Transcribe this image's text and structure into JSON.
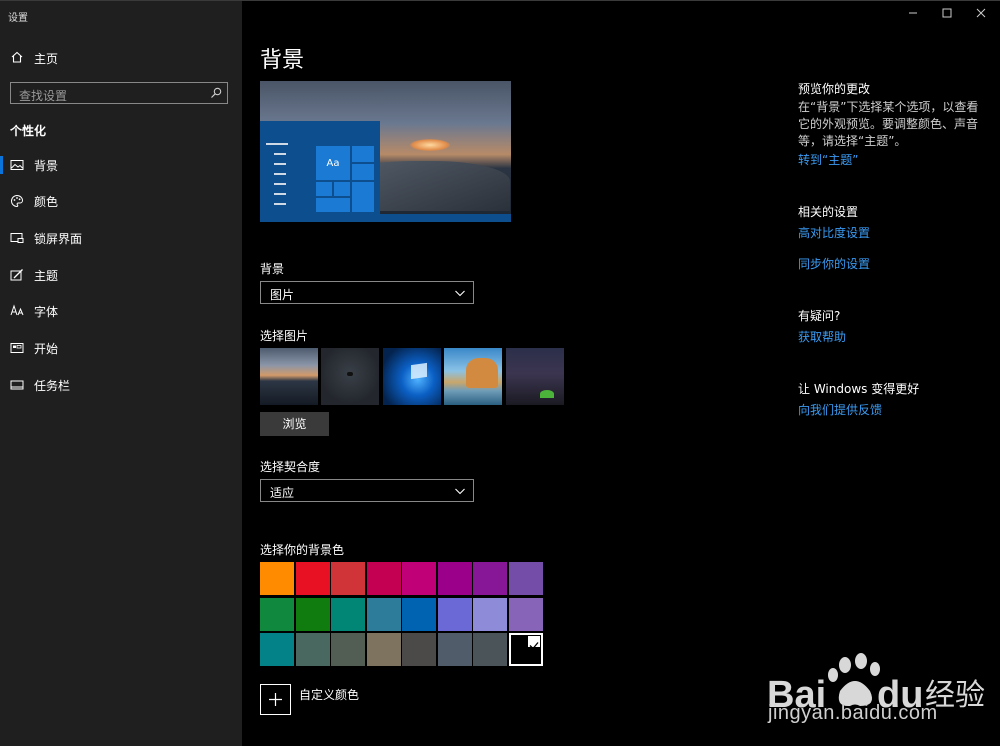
{
  "window": {
    "app_title": "设置"
  },
  "sidebar": {
    "home_label": "主页",
    "search_placeholder": "查找设置",
    "group_title": "个性化",
    "items": [
      {
        "label": "背景",
        "icon": "picture-icon",
        "active": true
      },
      {
        "label": "颜色",
        "icon": "palette-icon",
        "active": false
      },
      {
        "label": "锁屏界面",
        "icon": "lock-screen-icon",
        "active": false
      },
      {
        "label": "主题",
        "icon": "theme-icon",
        "active": false
      },
      {
        "label": "字体",
        "icon": "font-icon",
        "active": false
      },
      {
        "label": "开始",
        "icon": "start-icon",
        "active": false
      },
      {
        "label": "任务栏",
        "icon": "taskbar-icon",
        "active": false
      }
    ]
  },
  "main": {
    "page_title": "背景",
    "preview_sample_text": "Aa",
    "background_label": "背景",
    "background_value": "图片",
    "choose_picture_label": "选择图片",
    "browse_label": "浏览",
    "fit_label": "选择契合度",
    "fit_value": "适应",
    "color_label": "选择你的背景色",
    "custom_color_label": "自定义颜色",
    "colors": [
      "#ff8c00",
      "#e81123",
      "#d13438",
      "#c30052",
      "#bf0077",
      "#9a0089",
      "#881798",
      "#744da9",
      "#10893e",
      "#107c10",
      "#018574",
      "#2d7d9a",
      "#0063b1",
      "#6b69d6",
      "#8e8cd8",
      "#8764b8",
      "#038387",
      "#486860",
      "#525e54",
      "#7e735f",
      "#4c4a48",
      "#515c6b",
      "#4a5459",
      "#000000"
    ],
    "selected_color": "#000000"
  },
  "right": {
    "preview_heading": "预览你的更改",
    "preview_body": "在“背景”下选择某个选项，以查看它的外观预览。要调整颜色、声音等，请选择“主题”。",
    "preview_link": "转到“主题”",
    "related_heading": "相关的设置",
    "related_links": [
      "高对比度设置",
      "同步你的设置"
    ],
    "help_heading": "有疑问?",
    "help_link": "获取帮助",
    "feedback_heading": "让 Windows 变得更好",
    "feedback_link": "向我们提供反馈"
  },
  "watermark": {
    "url_text": "jingyan.baidu.com"
  }
}
